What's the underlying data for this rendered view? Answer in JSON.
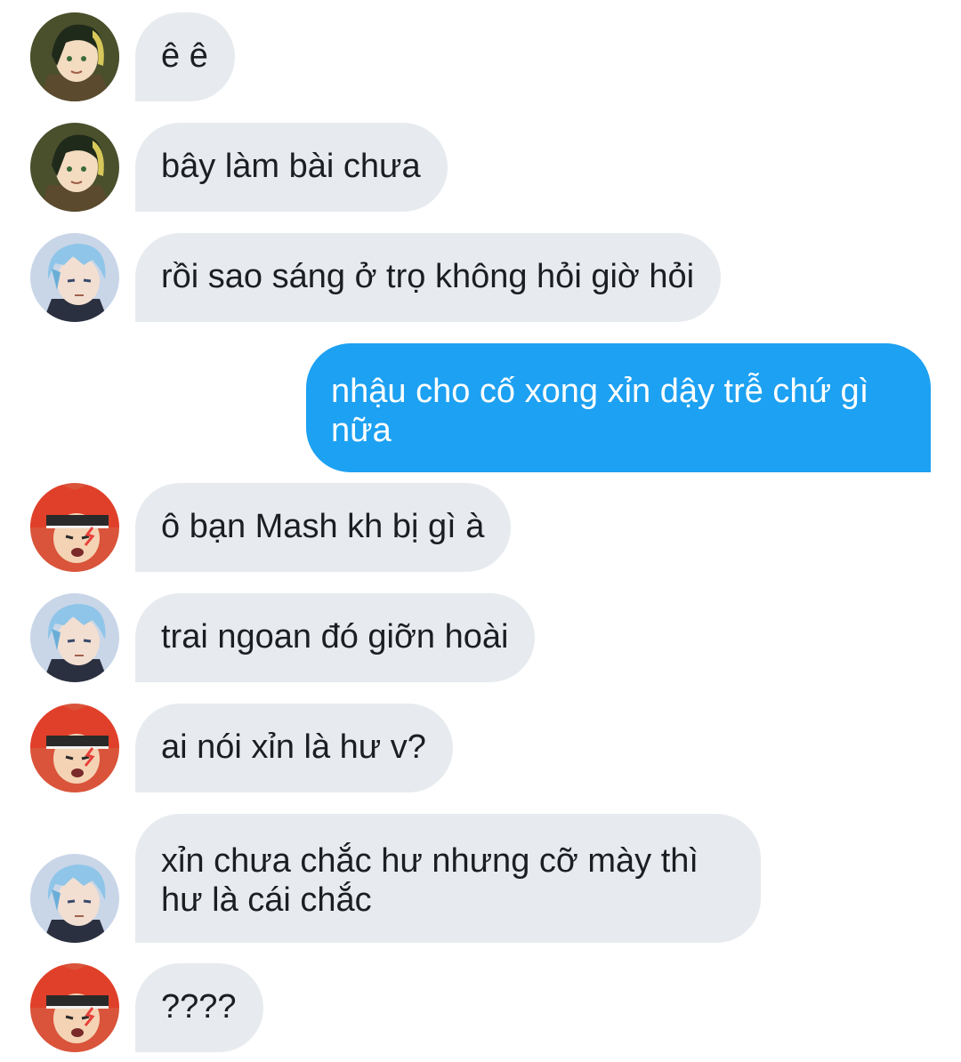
{
  "colors": {
    "incoming_bubble": "#e7ebef",
    "outgoing_bubble": "#1da1f2",
    "incoming_text": "#1c1e21",
    "outgoing_text": "#ffffff"
  },
  "messages": [
    {
      "sender": "green-haired-user",
      "direction": "incoming",
      "text": "ê ê"
    },
    {
      "sender": "green-haired-user",
      "direction": "incoming",
      "text": "bây làm bài chưa"
    },
    {
      "sender": "blue-haired-user",
      "direction": "incoming",
      "text": "rồi sao sáng ở trọ không hỏi giờ hỏi"
    },
    {
      "sender": "me",
      "direction": "outgoing",
      "text": "nhậu cho cố xong xỉn dậy trễ chứ gì nữa"
    },
    {
      "sender": "red-haired-user",
      "direction": "incoming",
      "text": "ô bạn Mash kh bị gì à"
    },
    {
      "sender": "blue-haired-user",
      "direction": "incoming",
      "text": "trai ngoan đó giỡn hoài"
    },
    {
      "sender": "red-haired-user",
      "direction": "incoming",
      "text": "ai nói xỉn là hư v?"
    },
    {
      "sender": "blue-haired-user",
      "direction": "incoming",
      "text": "xỉn chưa chắc hư nhưng cỡ mày thì hư là cái chắc"
    },
    {
      "sender": "red-haired-user",
      "direction": "incoming",
      "text": "????"
    }
  ]
}
